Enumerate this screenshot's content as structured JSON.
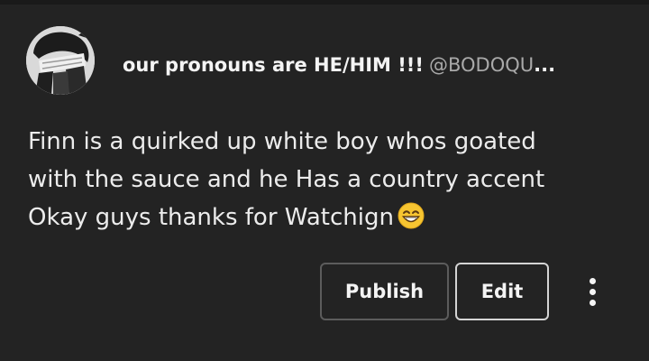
{
  "post": {
    "author_name": "our pronouns are HE/HIM !!!",
    "author_handle": "@BODOQU",
    "truncation": "...",
    "avatar_icon": "avatar-icon",
    "lines": [
      "Finn is a quirked up white boy whos goated",
      "with the sauce and he Has a country accent",
      "Okay guys thanks for Watchign"
    ],
    "emoji": "grinning-face-emoji"
  },
  "actions": {
    "publish_label": "Publish",
    "edit_label": "Edit",
    "more_icon": "more-vertical-icon"
  },
  "colors": {
    "background": "#232323",
    "text": "#ececec",
    "handle": "#a9a9a9",
    "publish_border": "#5c5c5c",
    "edit_border": "#d4d4d4"
  }
}
